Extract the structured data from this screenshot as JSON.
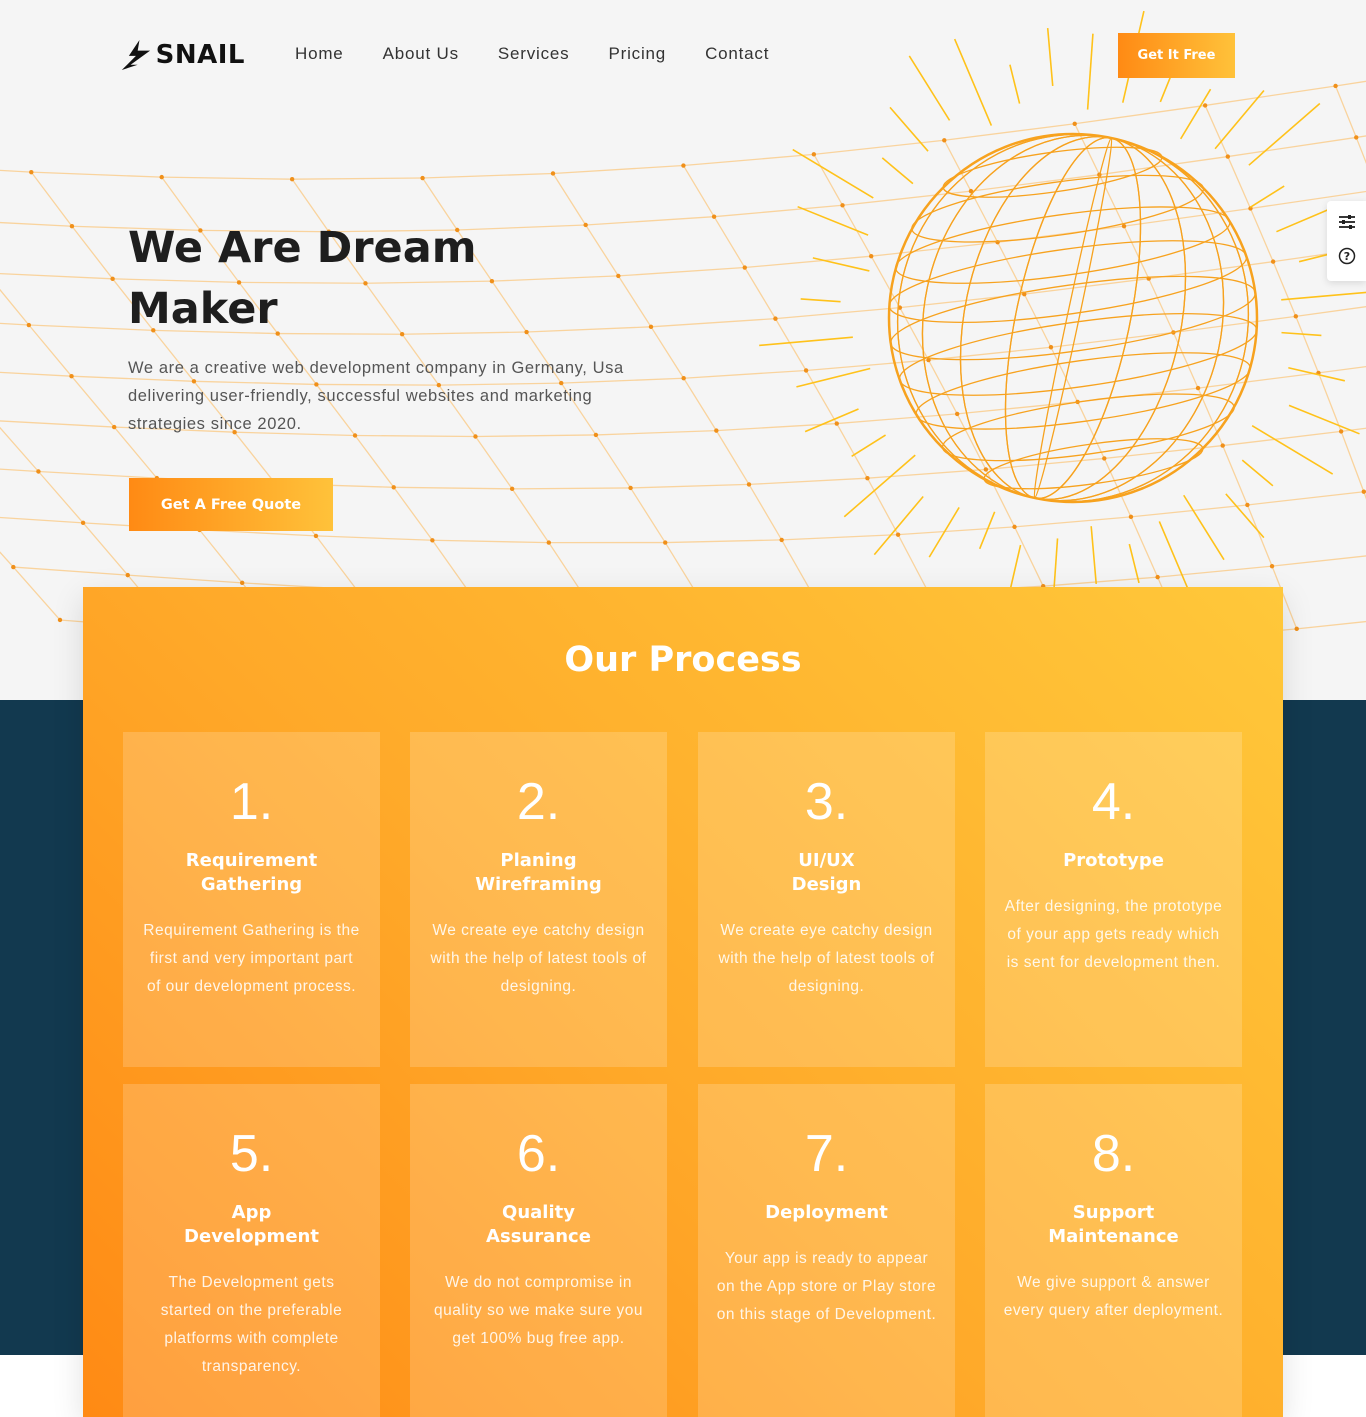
{
  "brand": {
    "logo_text": "SNAIL",
    "accent": "#ffa01e",
    "dark": "#12394f"
  },
  "nav": {
    "items": [
      "Home",
      "About Us",
      "Services",
      "Pricing",
      "Contact"
    ]
  },
  "header": {
    "cta_label": "Get It Free"
  },
  "side_widget": {
    "icons": [
      "sliders-icon",
      "help-circle-icon"
    ]
  },
  "hero": {
    "title_line1": "We Are Dream",
    "title_line2": "Maker",
    "description": "We are a creative web development company in Germany, Usa delivering user-friendly, successful websites and marketing strategies since 2020.",
    "cta_label": "Get A Free Quote"
  },
  "process": {
    "title": "Our Process",
    "steps": [
      {
        "num": "1.",
        "title_l1": "Requirement",
        "title_l2": "Gathering",
        "text": "Requirement Gathering is the first and very important part of our development process."
      },
      {
        "num": "2.",
        "title_l1": "Planing",
        "title_l2": "Wireframing",
        "text": "We create eye catchy design with the help of latest tools of designing."
      },
      {
        "num": "3.",
        "title_l1": "UI/UX",
        "title_l2": "Design",
        "text": "We create eye catchy design with the help of latest tools of designing."
      },
      {
        "num": "4.",
        "title_l1": "Prototype",
        "title_l2": "",
        "text": "After designing, the prototype of your app gets ready which is sent for development then."
      },
      {
        "num": "5.",
        "title_l1": "App",
        "title_l2": "Development",
        "text": "The Development gets started on the preferable platforms with complete transparency."
      },
      {
        "num": "6.",
        "title_l1": "Quality",
        "title_l2": "Assurance",
        "text": "We do not compromise in quality so we make sure you get 100% bug free app."
      },
      {
        "num": "7.",
        "title_l1": "Deployment",
        "title_l2": "",
        "text": "Your app is ready to appear on the App store or Play store on this stage of Development."
      },
      {
        "num": "8.",
        "title_l1": "Support",
        "title_l2": "Maintenance",
        "text": "We give support & answer every query after deployment."
      }
    ]
  }
}
